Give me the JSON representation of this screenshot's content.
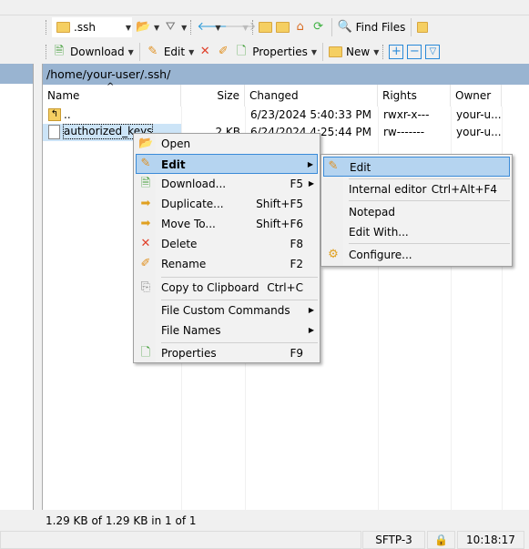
{
  "toolbar1": {
    "location": ".ssh",
    "find_files": "Find Files"
  },
  "toolbar2": {
    "download": "Download",
    "edit": "Edit",
    "properties": "Properties",
    "new": "New"
  },
  "panel": {
    "path": "/home/your-user/.ssh/",
    "columns": [
      "Name",
      "Size",
      "Changed",
      "Rights",
      "Owner"
    ],
    "rows": [
      {
        "name": "..",
        "size": "",
        "changed": "6/23/2024 5:40:33 PM",
        "rights": "rwxr-x---",
        "owner": "your-u..."
      },
      {
        "name": "authorized_keys",
        "size": "2 KB",
        "changed": "6/24/2024 4:25:44 PM",
        "rights": "rw-------",
        "owner": "your-u..."
      }
    ]
  },
  "context_menu": {
    "items": [
      {
        "label": "Open",
        "shortcut": "",
        "icon": "folder-open-icon"
      },
      {
        "label": "Edit",
        "shortcut": "",
        "icon": "edit-icon"
      },
      {
        "label": "Download...",
        "shortcut": "F5",
        "icon": "download-icon"
      },
      {
        "label": "Duplicate...",
        "shortcut": "Shift+F5",
        "icon": "duplicate-icon"
      },
      {
        "label": "Move To...",
        "shortcut": "Shift+F6",
        "icon": "move-icon"
      },
      {
        "label": "Delete",
        "shortcut": "F8",
        "icon": "delete-icon"
      },
      {
        "label": "Rename",
        "shortcut": "F2",
        "icon": "rename-icon"
      },
      {
        "label": "Copy to Clipboard",
        "shortcut": "Ctrl+C",
        "icon": "clipboard-icon"
      },
      {
        "label": "File Custom Commands",
        "shortcut": "",
        "icon": ""
      },
      {
        "label": "File Names",
        "shortcut": "",
        "icon": ""
      },
      {
        "label": "Properties",
        "shortcut": "F9",
        "icon": "properties-icon"
      }
    ]
  },
  "edit_submenu": {
    "items": [
      {
        "label": "Edit",
        "shortcut": ""
      },
      {
        "label": "Internal editor",
        "shortcut": "Ctrl+Alt+F4"
      },
      {
        "label": "Notepad",
        "shortcut": ""
      },
      {
        "label": "Edit With...",
        "shortcut": ""
      },
      {
        "label": "Configure...",
        "shortcut": ""
      }
    ]
  },
  "status": {
    "selection": "1.29 KB of 1.29 KB in 1 of 1",
    "protocol": "SFTP-3",
    "time": "10:18:17"
  },
  "colors": {
    "path_bar": "#99b4d1",
    "highlight": "#b5d4f0",
    "highlight_border": "#3a8bd8"
  }
}
